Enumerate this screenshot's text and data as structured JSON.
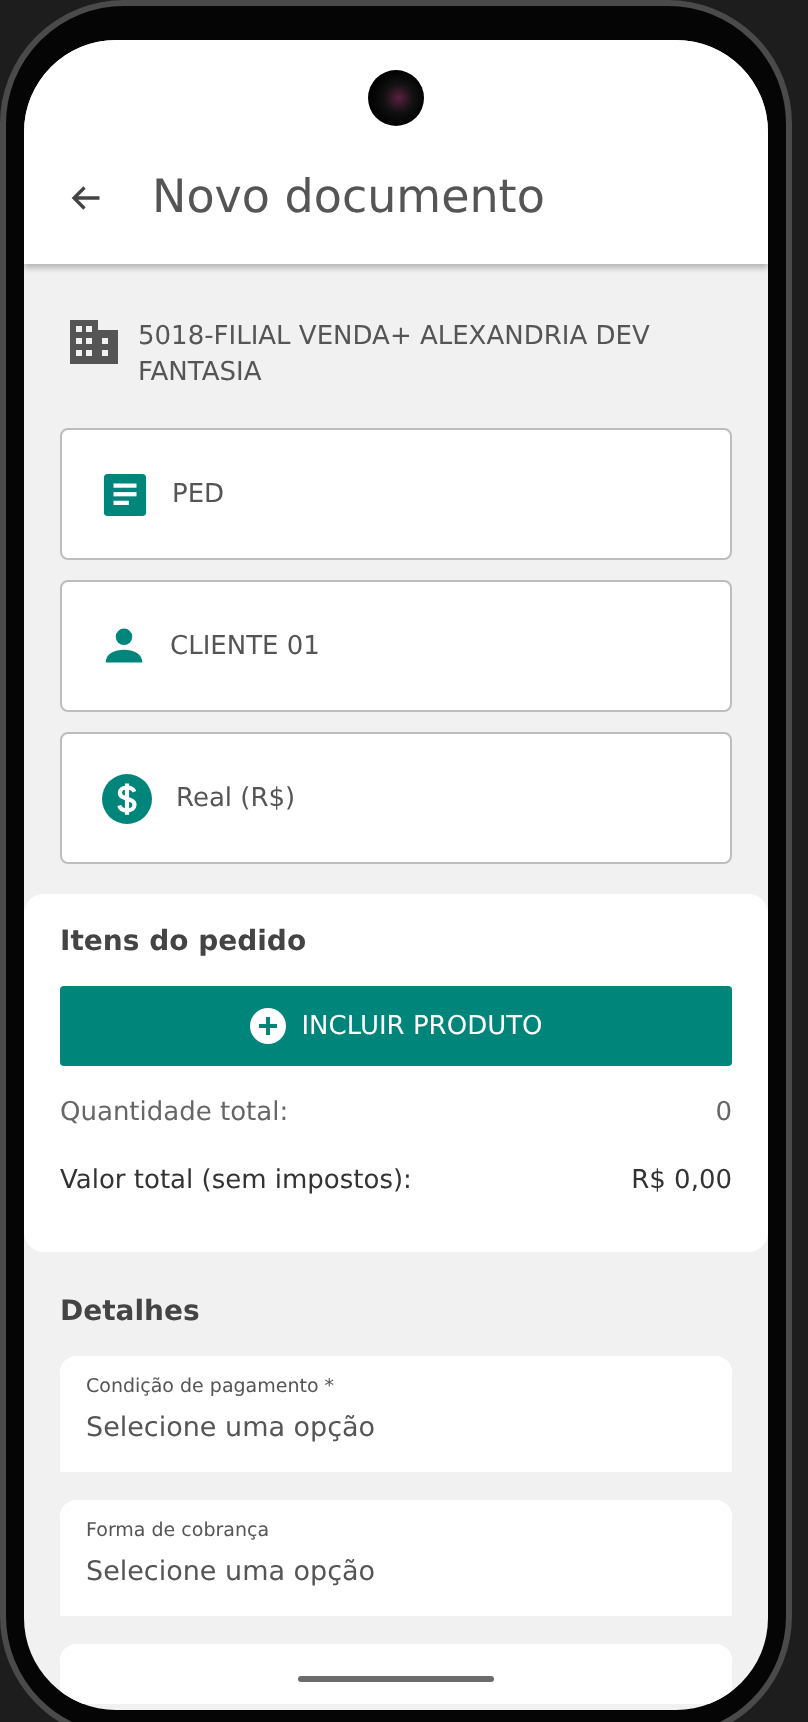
{
  "header": {
    "title": "Novo documento"
  },
  "branch": {
    "label": "5018-FILIAL VENDA+ ALEXANDRIA DEV FANTASIA"
  },
  "selectors": [
    {
      "kind": "document",
      "label": "PED"
    },
    {
      "kind": "customer",
      "label": "CLIENTE 01"
    },
    {
      "kind": "currency",
      "label": "Real (R$)"
    }
  ],
  "order_items": {
    "title": "Itens do pedido",
    "button": "INCLUIR PRODUTO",
    "totals": [
      {
        "label": "Quantidade total:",
        "value": "0",
        "emphasis": false
      },
      {
        "label": "Valor total (sem impostos):",
        "value": "R$ 0,00",
        "emphasis": true
      }
    ]
  },
  "details": {
    "title": "Detalhes",
    "fields": [
      {
        "label": "Condição de pagamento *",
        "placeholder": "Selecione uma opção"
      },
      {
        "label": "Forma de cobrança",
        "placeholder": "Selecione uma opção"
      }
    ]
  }
}
